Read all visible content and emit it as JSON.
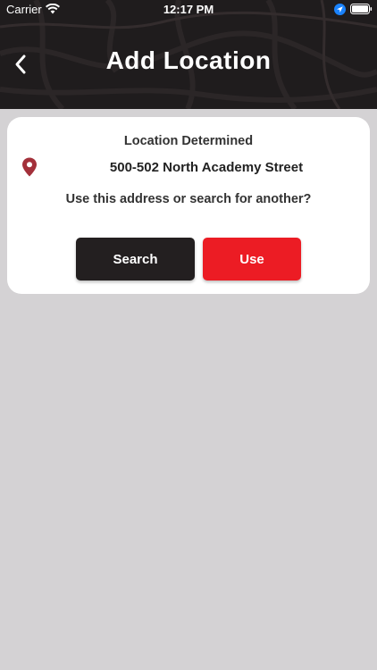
{
  "status_bar": {
    "carrier": "Carrier",
    "time": "12:17 PM",
    "icons": [
      "wifi-icon",
      "location-arrow-icon",
      "battery-icon"
    ]
  },
  "header": {
    "title": "Add Location",
    "back_icon": "chevron-left-icon",
    "background_color": "#1f1c1d"
  },
  "card": {
    "heading": "Location Determined",
    "pin_icon": "map-pin-icon",
    "pin_color": "#a3303a",
    "address": "500-502 North Academy Street",
    "prompt": "Use this address or search for another?",
    "search_label": "Search",
    "use_label": "Use",
    "search_color": "#231f20",
    "use_color": "#ec1c24"
  },
  "page_background": "#d4d2d4"
}
